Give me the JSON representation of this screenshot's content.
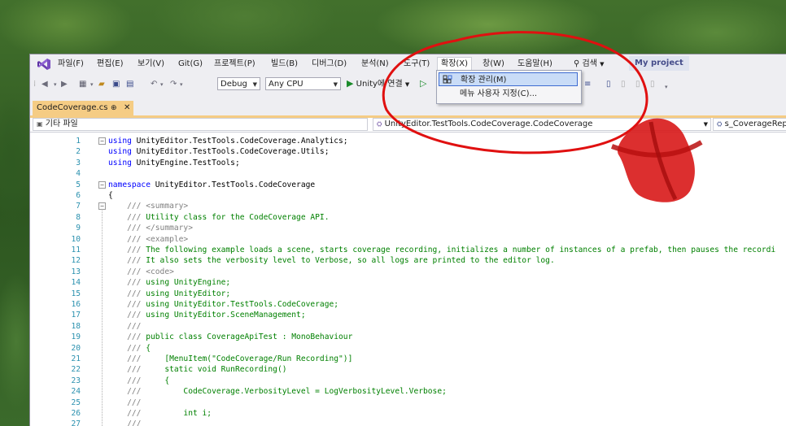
{
  "menubar": {
    "items": [
      "파일(F)",
      "편집(E)",
      "보기(V)",
      "Git(G)",
      "프로젝트(P)",
      "빌드(B)",
      "디버그(D)",
      "분석(N)",
      "도구(T)",
      "확장(X)",
      "창(W)",
      "도움말(H)"
    ],
    "search": "검색",
    "project": "My project"
  },
  "toolbar": {
    "config": "Debug",
    "platform": "Any CPU",
    "run_label": "Unity에 연결"
  },
  "dropdown": {
    "items": [
      "확장 관리(M)",
      "메뉴 사용자 지정(C)..."
    ]
  },
  "tab": {
    "filename": "CodeCoverage.cs",
    "pin": "⊕",
    "close": "✕"
  },
  "navbar": {
    "project": "기타 파일",
    "class": "UnityEditor.TestTools.CodeCoverage.CodeCoverage",
    "member": "s_CoverageReport"
  },
  "editor": {
    "lines": [
      {
        "n": "1",
        "t": "using UnityEditor.TestTools.CodeCoverage.Analytics;"
      },
      {
        "n": "2",
        "t": "using UnityEditor.TestTools.CodeCoverage.Utils;"
      },
      {
        "n": "3",
        "t": "using UnityEngine.TestTools;"
      },
      {
        "n": "4",
        "t": ""
      },
      {
        "n": "5",
        "t": "namespace UnityEditor.TestTools.CodeCoverage"
      },
      {
        "n": "6",
        "t": "{"
      },
      {
        "n": "7",
        "t": "    /// <summary>"
      },
      {
        "n": "8",
        "t": "    /// Utility class for the CodeCoverage API."
      },
      {
        "n": "9",
        "t": "    /// </summary>"
      },
      {
        "n": "10",
        "t": "    /// <example>"
      },
      {
        "n": "11",
        "t": "    /// The following example loads a scene, starts coverage recording, initializes a number of instances of a prefab, then pauses the recordi"
      },
      {
        "n": "12",
        "t": "    /// It also sets the verbosity level to Verbose, so all logs are printed to the editor log."
      },
      {
        "n": "13",
        "t": "    /// <code>"
      },
      {
        "n": "14",
        "t": "    /// using UnityEngine;"
      },
      {
        "n": "15",
        "t": "    /// using UnityEditor;"
      },
      {
        "n": "16",
        "t": "    /// using UnityEditor.TestTools.CodeCoverage;"
      },
      {
        "n": "17",
        "t": "    /// using UnityEditor.SceneManagement;"
      },
      {
        "n": "18",
        "t": "    ///"
      },
      {
        "n": "19",
        "t": "    /// public class CoverageApiTest : MonoBehaviour"
      },
      {
        "n": "20",
        "t": "    /// {"
      },
      {
        "n": "21",
        "t": "    ///     [MenuItem(\"CodeCoverage/Run Recording\")]"
      },
      {
        "n": "22",
        "t": "    ///     static void RunRecording()"
      },
      {
        "n": "23",
        "t": "    ///     {"
      },
      {
        "n": "24",
        "t": "    ///         CodeCoverage.VerbosityLevel = LogVerbosityLevel.Verbose;"
      },
      {
        "n": "25",
        "t": "    ///"
      },
      {
        "n": "26",
        "t": "    ///         int i;"
      },
      {
        "n": "27",
        "t": "    ///"
      }
    ]
  },
  "colors": {
    "accent_tab": "#f5cc84",
    "keyword": "#0000ff",
    "comment": "#008000",
    "line_number": "#2b91af",
    "annotation": "#e01010"
  }
}
